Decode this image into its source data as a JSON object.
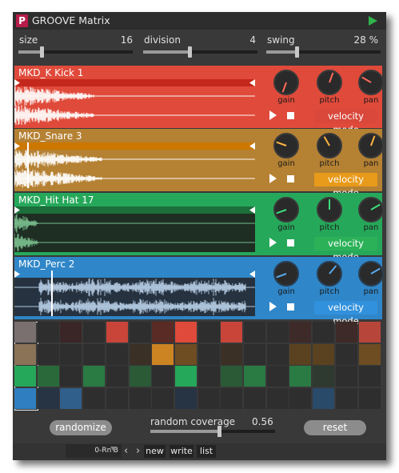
{
  "app": {
    "logo_letter": "P",
    "title": "GROOVE Matrix"
  },
  "controls": {
    "size": {
      "label": "size",
      "value": "16",
      "level": 0.2
    },
    "division": {
      "label": "division",
      "value": "4",
      "level": 0.38
    },
    "swing": {
      "label": "swing",
      "value": "28 %",
      "level": 0.28
    }
  },
  "tracks": [
    {
      "name": "MKD_K Kick 1",
      "color": "#e04a3a",
      "bar_color": "#c4271b",
      "wave_bg": "#e04a3a",
      "wave_color": "#ffffff",
      "knob_labels": {
        "gain": "gain",
        "pitch": "pitch",
        "pan": "pan"
      },
      "velocity_label": "velocity mode",
      "velocity_color": "#d9483b"
    },
    {
      "name": "MKD_Snare 3",
      "color": "#b58133",
      "bar_color": "#cc7700",
      "wave_bg": "#b58133",
      "wave_color": "#ffffff",
      "knob_labels": {
        "gain": "gain",
        "pitch": "pitch",
        "pan": "pan"
      },
      "velocity_label": "velocity mode",
      "velocity_color": "#e89a1a"
    },
    {
      "name": "MKD_Hit Hat 17",
      "color": "#26a85a",
      "bar_color": "#1c6e3a",
      "wave_bg": "#1e2e23",
      "wave_color": "#7ac08e",
      "knob_labels": {
        "gain": "gain",
        "pitch": "pitch",
        "pan": "pan"
      },
      "velocity_label": "velocity mode",
      "velocity_color": "#2bb158"
    },
    {
      "name": "MKD_Perc 2",
      "color": "#2f86c8",
      "bar_color": "#2f86c8",
      "wave_bg": "#263240",
      "wave_color": "#b7cde6",
      "knob_labels": {
        "gain": "gain",
        "pitch": "pitch",
        "pan": "pan"
      },
      "velocity_label": "velocity mode",
      "velocity_color": "#3291dc"
    }
  ],
  "matrix": {
    "rows": [
      [
        "#7a7070",
        "#2e2e2e",
        "#3a2626",
        "#2e2e2e",
        "#c9453a",
        "#2e2e2e",
        "#5a2a24",
        "#e04a3a",
        "#2e2e2e",
        "#c9453a",
        "#2e2e2e",
        "#2e2e2e",
        "#3e2a28",
        "#2e2e2e",
        "#3e2a28",
        "#b8453a"
      ],
      [
        "#8b7358",
        "#2e2e2e",
        "#2e2e2e",
        "#2e2e2e",
        "#2e2e2e",
        "#3a3026",
        "#cc8422",
        "#6e4d22",
        "#2e2e2e",
        "#3a3026",
        "#2e2e2e",
        "#2e2e2e",
        "#5a4220",
        "#5a4220",
        "#2e2e2e",
        "#6e4d22"
      ],
      [
        "#26a85a",
        "#2a6a3a",
        "#2e2e2e",
        "#2a7a44",
        "#2e2e2e",
        "#2a5a36",
        "#2e2e2e",
        "#26a85a",
        "#2e2e2e",
        "#2a5a36",
        "#2a7a44",
        "#2e2e2e",
        "#2a7a44",
        "#2e3a30",
        "#2e2e2e",
        "#2e2e2e"
      ],
      [
        "#2f7fc0",
        "#263444",
        "#2f5f8a",
        "#2e2e2e",
        "#2e2e2e",
        "#2e2e2e",
        "#2e2e2e",
        "#263444",
        "#2e2e2e",
        "#2e2e2e",
        "#2e2e2e",
        "#2e2e2e",
        "#2e2e2e",
        "#2a4a6a",
        "#2e2e2e",
        "#2e2e2e"
      ]
    ]
  },
  "bottom": {
    "randomize_label": "randomize",
    "coverage_label": "random coverage",
    "coverage_value": "0.56",
    "coverage_level": 0.56,
    "reset_label": "reset"
  },
  "footer": {
    "preset": "0-Rn'B",
    "prev_icon": "chevron-left-icon",
    "next_icon": "chevron-right-icon",
    "new_label": "new",
    "write_label": "write",
    "list_label": "list"
  }
}
